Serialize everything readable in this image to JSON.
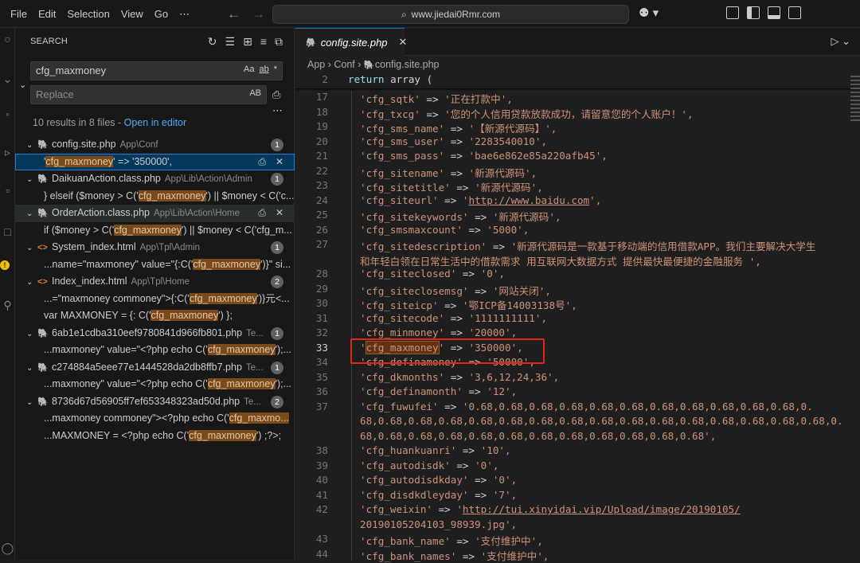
{
  "menu": [
    "File",
    "Edit",
    "Selection",
    "View",
    "Go",
    "⋯"
  ],
  "address": "www.jiedai0Rmr.com",
  "sidebar": {
    "title": "SEARCH",
    "search_value": "cfg_maxmoney",
    "replace_placeholder": "Replace",
    "search_opts": [
      "Aa",
      "ab",
      "*"
    ],
    "replace_opt": "AB",
    "results_text": "10 results in 8 files - ",
    "open_editor": "Open in editor",
    "tree": [
      {
        "kind": "file",
        "icon": "php",
        "name": "config.site.php",
        "path": "App\\Conf",
        "count": "1"
      },
      {
        "kind": "match",
        "pre": "'",
        "hl": "cfg_maxmoney",
        "post": "' => '350000',",
        "selected": true
      },
      {
        "kind": "file",
        "icon": "php",
        "name": "DaikuanAction.class.php",
        "path": "App\\Lib\\Action\\Admin",
        "count": "1"
      },
      {
        "kind": "match",
        "pre": "} elseif ($money > C('",
        "hl": "cfg_maxmoney",
        "post": "') || $money < C('c..."
      },
      {
        "kind": "file",
        "icon": "php",
        "name": "OrderAction.class.php",
        "path": "App\\Lib\\Action\\Home",
        "count": "",
        "hover": true
      },
      {
        "kind": "match",
        "pre": "if ($money > C('",
        "hl": "cfg_maxmoney",
        "post": "') || $money < C('cfg_m..."
      },
      {
        "kind": "file",
        "icon": "html",
        "name": "System_index.html",
        "path": "App\\Tpl\\Admin",
        "count": "1"
      },
      {
        "kind": "match",
        "pre": "...name=\"maxmoney\" value=\"{:C('",
        "hl": "cfg_maxmoney",
        "post": "')}\" si..."
      },
      {
        "kind": "file",
        "icon": "html",
        "name": "Index_index.html",
        "path": "App\\Tpl\\Home",
        "count": "2"
      },
      {
        "kind": "match",
        "pre": "...=\"maxmoney commoney\">{:C('",
        "hl": "cfg_maxmoney",
        "post": "')}元<..."
      },
      {
        "kind": "match",
        "pre": "var MAXMONEY = {: C('",
        "hl": "cfg_maxmoney",
        "post": "') };"
      },
      {
        "kind": "file",
        "icon": "php",
        "name": "6ab1e1cdba310eef9780841d966fb801.php",
        "path": "Te...",
        "count": "1"
      },
      {
        "kind": "match",
        "pre": "...maxmoney\" value=\"<?php echo C('",
        "hl": "cfg_maxmoney",
        "post": "');..."
      },
      {
        "kind": "file",
        "icon": "php",
        "name": "c274884a5eee77e1444528da2db8ffb7.php",
        "path": "Te...",
        "count": "1"
      },
      {
        "kind": "match",
        "pre": "...maxmoney\" value=\"<?php echo C('",
        "hl": "cfg_maxmoney",
        "post": "');..."
      },
      {
        "kind": "file",
        "icon": "php",
        "name": "8736d67d56905ff7ef653348323ad50d.php",
        "path": "Te...",
        "count": "2"
      },
      {
        "kind": "match",
        "pre": "...maxmoney commoney\"><?php echo C('",
        "hl": "cfg_maxmo...",
        "post": ""
      },
      {
        "kind": "match",
        "pre": "...MAXMONEY = <?php echo C('",
        "hl": "cfg_maxmoney",
        "post": "') ;?>;"
      }
    ]
  },
  "editor": {
    "tab": "config.site.php",
    "crumbs": [
      "App",
      "Conf",
      "config.site.php"
    ],
    "sticky": {
      "num": "2",
      "kw": "return",
      "rest": " array ("
    },
    "lines": [
      {
        "n": "17",
        "t": "'cfg_sqtk' => '正在打款中',"
      },
      {
        "n": "18",
        "t": "'cfg_txcg' => '您的个人信用贷款放款成功，请留意您的个人账户！',"
      },
      {
        "n": "19",
        "t": "'cfg_sms_name' => '【新源代源码】',"
      },
      {
        "n": "20",
        "t": "'cfg_sms_user' => '2283540010',"
      },
      {
        "n": "21",
        "t": "'cfg_sms_pass' => 'bae6e862e85a220afb45',"
      },
      {
        "n": "22",
        "t": "'cfg_sitename' => '新源代源码',"
      },
      {
        "n": "23",
        "t": "'cfg_sitetitle' => '新源代源码',"
      },
      {
        "n": "24",
        "t": "'cfg_siteurl' => 'http://www.baidu.com',"
      },
      {
        "n": "25",
        "t": "'cfg_sitekeywords' => '新源代源码',"
      },
      {
        "n": "26",
        "t": "'cfg_smsmaxcount' => '5000',"
      },
      {
        "n": "27",
        "t": "'cfg_sitedescription' => '新源代源码是一款基于移动端的信用借款APP。我们主要解决大学生"
      },
      {
        "n": "",
        "t": "和年轻白领在日常生活中的借款需求 用互联网大数据方式 提供最快最便捷的金融服务 ',"
      },
      {
        "n": "28",
        "t": "'cfg_siteclosed' => '0',"
      },
      {
        "n": "29",
        "t": "'cfg_siteclosemsg' => '网站关闭',"
      },
      {
        "n": "30",
        "t": "'cfg_siteicp' => '鄂ICP备14003138号',"
      },
      {
        "n": "31",
        "t": "'cfg_sitecode' => '1111111111',"
      },
      {
        "n": "32",
        "t": "'cfg_minmoney' => '20000',"
      },
      {
        "n": "33",
        "t": "' => '350000',",
        "hl": "cfg_maxmoney"
      },
      {
        "n": "34",
        "t": "'cfg_definamoney' => '50000',"
      },
      {
        "n": "35",
        "t": "'cfg_dkmonths' => '3,6,12,24,36',"
      },
      {
        "n": "36",
        "t": "'cfg_definamonth' => '12',"
      },
      {
        "n": "37",
        "t": "'cfg_fuwufei' => '0.68,0.68,0.68,0.68,0.68,0.68,0.68,0.68,0.68,0.68,0.68,0."
      },
      {
        "n": "",
        "t": "68,0.68,0.68,0.68,0.68,0.68,0.68,0.68,0.68,0.68,0.68,0.68,0.68,0.68,0.68,0.68,0."
      },
      {
        "n": "",
        "t": "68,0.68,0.68,0.68,0.68,0.68,0.68,0.68,0.68,0.68,0.68,0.68',"
      },
      {
        "n": "38",
        "t": "'cfg_huankuanri' => '10',"
      },
      {
        "n": "39",
        "t": "'cfg_autodisdk' => '0',"
      },
      {
        "n": "40",
        "t": "'cfg_autodisdkday' => '0',"
      },
      {
        "n": "41",
        "t": "'cfg_disdkdleyday' => '7',"
      },
      {
        "n": "42",
        "t": "'cfg_weixin' => 'http://tui.xinyidai.vip/Upload/image/20190105/"
      },
      {
        "n": "",
        "t": "20190105204103_98939.jpg',"
      },
      {
        "n": "43",
        "t": "'cfg_bank_name' => '支付维护中',"
      },
      {
        "n": "44",
        "t": "'cfg_bank_names' => '支付维护中',"
      }
    ]
  }
}
